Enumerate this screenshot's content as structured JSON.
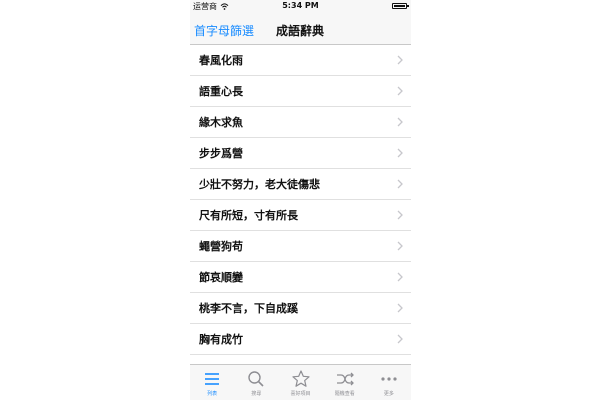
{
  "status_bar": {
    "carrier": "运营商",
    "time": "5:34 PM"
  },
  "nav": {
    "left_button": "首字母篩選",
    "title": "成語辭典"
  },
  "list": {
    "items": [
      "春風化雨",
      "語重心長",
      "緣木求魚",
      "步步爲營",
      "少壯不努力，老大徒傷悲",
      "尺有所短，寸有所長",
      "蠅營狗苟",
      "節哀順變",
      "桃李不言，下自成蹊",
      "胸有成竹"
    ]
  },
  "tab_bar": {
    "active_index": 0,
    "active_color": "#1a8cff",
    "inactive_color": "#8e8e93",
    "tabs": [
      {
        "label": "列表",
        "icon": "list-icon"
      },
      {
        "label": "搜尋",
        "icon": "search-icon"
      },
      {
        "label": "喜好項目",
        "icon": "star-icon"
      },
      {
        "label": "隨機查看",
        "icon": "shuffle-icon"
      },
      {
        "label": "更多",
        "icon": "more-icon"
      }
    ]
  }
}
